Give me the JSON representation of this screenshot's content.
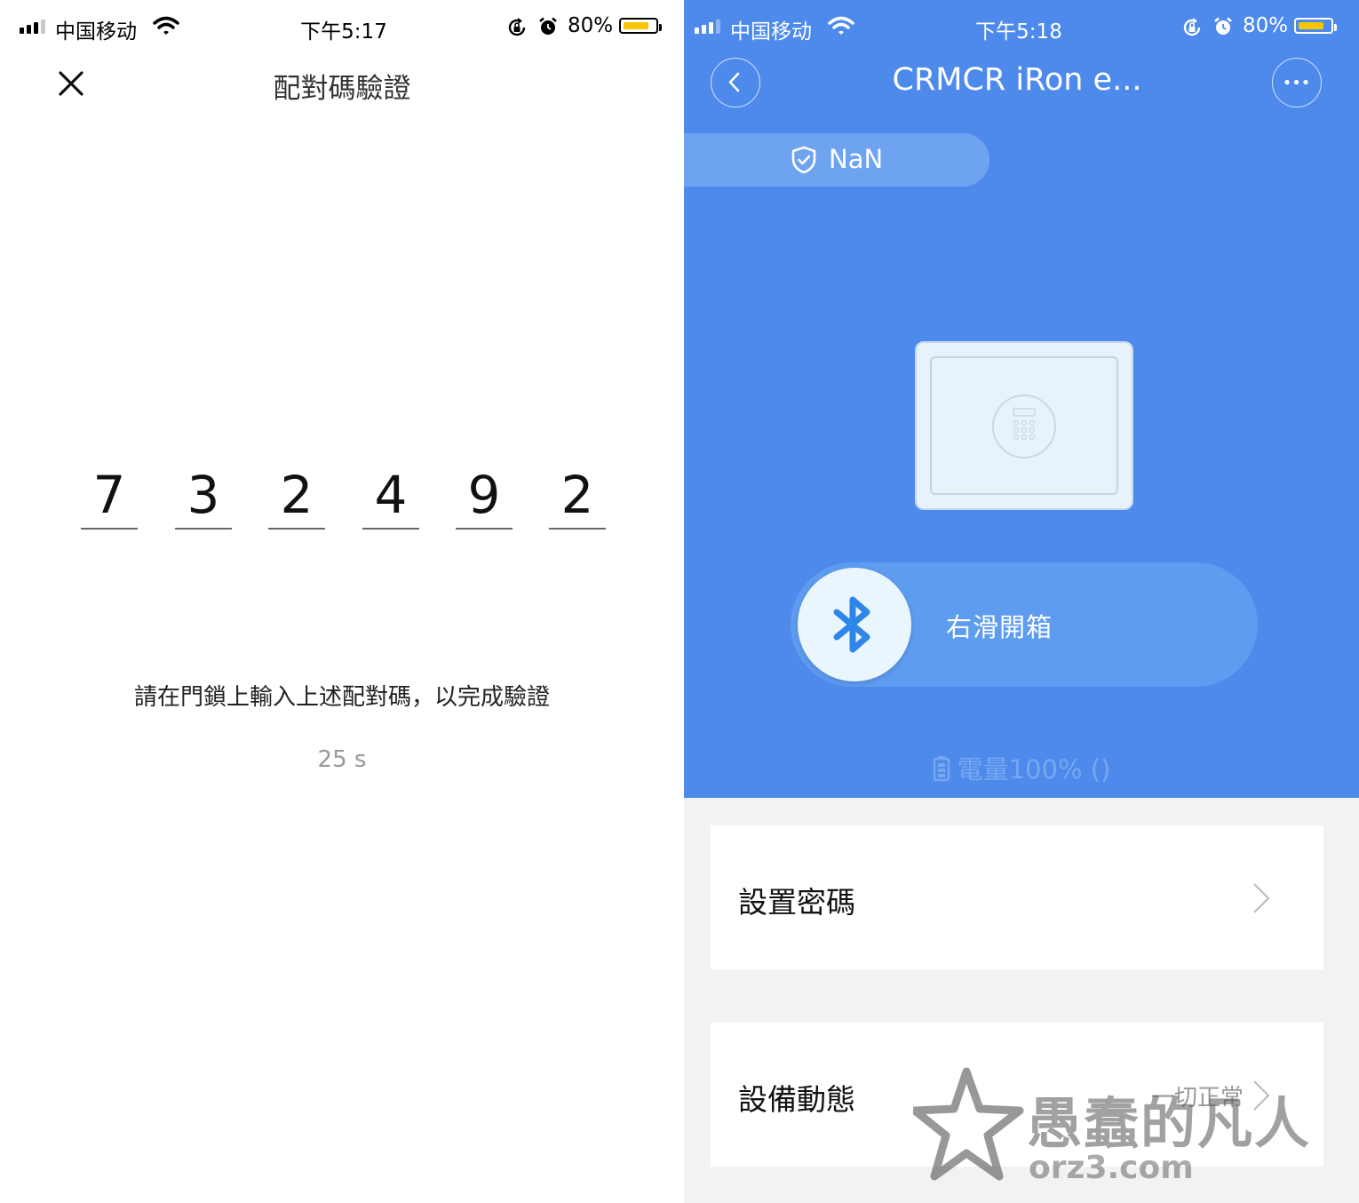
{
  "left": {
    "status": {
      "carrier": "中国移动",
      "time": "下午5:17",
      "battery": "80%"
    },
    "title": "配對碼驗證",
    "code_digits": [
      "7",
      "3",
      "2",
      "4",
      "9",
      "2"
    ],
    "instruction": "請在門鎖上輸入上述配對碼，以完成驗證",
    "countdown": "25 s",
    "icons": {
      "close": "close-icon"
    }
  },
  "right": {
    "status": {
      "carrier": "中国移动",
      "time": "下午5:18",
      "battery": "80%"
    },
    "title": "CRMCR iRon e...",
    "security_status": "NaN",
    "slider_label": "右滑開箱",
    "battery_text": "電量100% ()",
    "items": [
      {
        "label": "設置密碼",
        "value": ""
      },
      {
        "label": "設備動態",
        "value": "一切正常"
      }
    ],
    "icons": {
      "back": "back-icon",
      "more": "more-icon",
      "shield": "shield-icon",
      "bluetooth": "bluetooth-icon",
      "battery": "battery-icon",
      "chevron": "chevron-right-icon"
    }
  },
  "watermark": {
    "name": "愚蠢的凡人",
    "url": "orz3.com"
  },
  "colors": {
    "primary_blue": "#4d8aeb",
    "battery_fill": "#f7c600",
    "bluetooth": "#2f86e8"
  }
}
